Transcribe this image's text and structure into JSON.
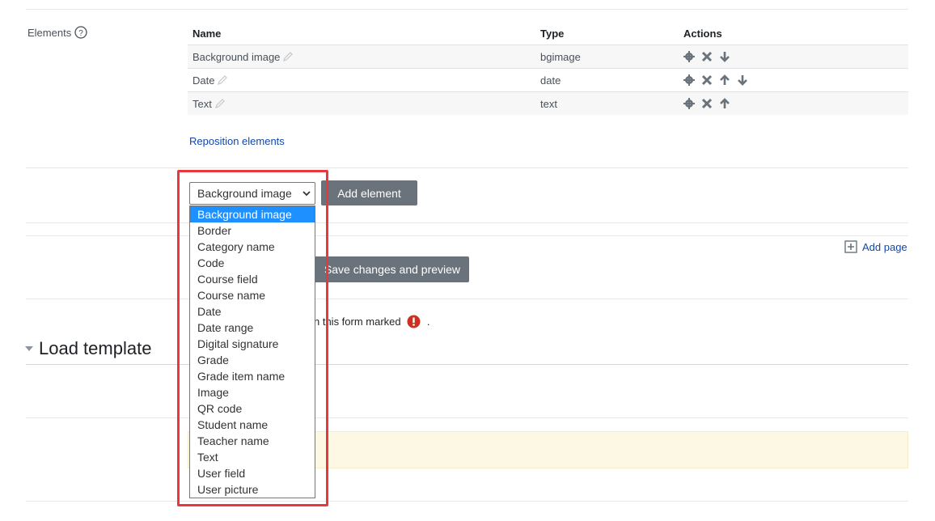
{
  "elements_section": {
    "label": "Elements",
    "help_icon": "question-circle-icon",
    "columns": [
      "Name",
      "Type",
      "Actions"
    ],
    "rows": [
      {
        "name": "Background image",
        "type": "bgimage",
        "actions": [
          "gear-icon",
          "delete-icon",
          "arrow-down-icon"
        ]
      },
      {
        "name": "Date",
        "type": "date",
        "actions": [
          "gear-icon",
          "delete-icon",
          "arrow-up-icon",
          "arrow-down-icon"
        ]
      },
      {
        "name": "Text",
        "type": "text",
        "actions": [
          "gear-icon",
          "delete-icon",
          "arrow-up-icon"
        ]
      }
    ],
    "reposition_link": "Reposition elements"
  },
  "add_element": {
    "selected": "Background image",
    "button_label": "Add element",
    "options": [
      "Background image",
      "Border",
      "Category name",
      "Code",
      "Course field",
      "Course name",
      "Date",
      "Date range",
      "Digital signature",
      "Grade",
      "Grade item name",
      "Image",
      "QR code",
      "Student name",
      "Teacher name",
      "Text",
      "User field",
      "User picture"
    ]
  },
  "page_actions": {
    "add_page_label": "Add page",
    "save_preview_label": "Save changes and preview"
  },
  "required_note": {
    "text": "n this form marked",
    "suffix": "."
  },
  "load_template": {
    "title": "Load template"
  },
  "colors": {
    "link": "#0f47ad",
    "button": "#6a737b",
    "selected_option": "#1e90ff",
    "highlight": "#e8383d",
    "required": "#ca3120",
    "note_bg": "#fcf8e3"
  }
}
